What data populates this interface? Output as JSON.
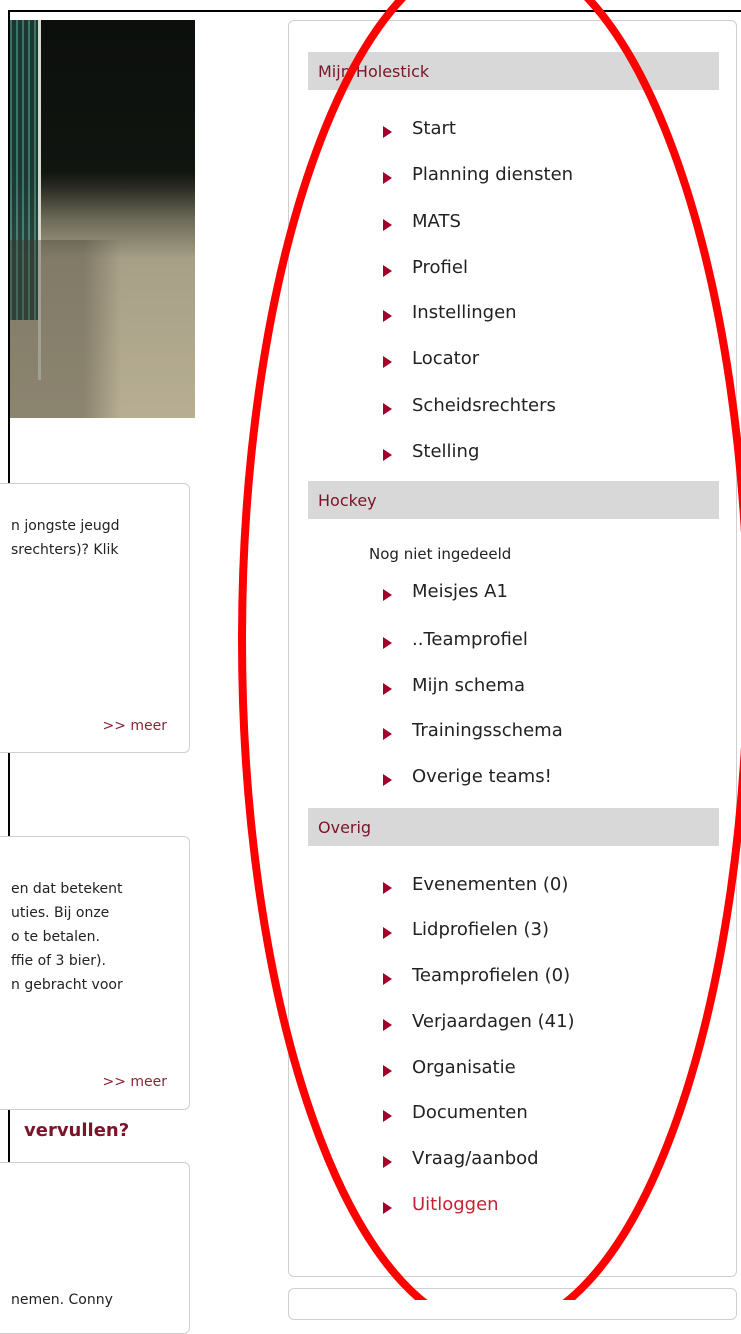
{
  "left_column": {
    "box1": {
      "lines": [
        "n jongste jeugd",
        "srechters)? Klik"
      ],
      "more_link": ">> meer"
    },
    "box2": {
      "lines": [
        "en dat betekent",
        "uties. Bij onze",
        "o te betalen.",
        "ffie of 3 bier).",
        "n gebracht voor"
      ],
      "more_link": ">> meer"
    },
    "heading": "vervullen?",
    "box3": {
      "lines": [
        "nemen. Conny"
      ]
    }
  },
  "sidebar": {
    "sections": [
      {
        "title": "Mijn Holestick",
        "items": [
          "Start",
          "Planning diensten",
          "MATS",
          "Profiel",
          "Instellingen",
          "Locator",
          "Scheidsrechters",
          "Stelling"
        ]
      },
      {
        "title": "Hockey",
        "subheading": "Nog niet ingedeeld",
        "items": [
          "Meisjes A1",
          "..Teamprofiel",
          "Mijn schema",
          "Trainingsschema",
          "Overige teams!"
        ]
      },
      {
        "title": "Overig",
        "items": [
          "Evenementen (0)",
          "Lidprofielen (3)",
          "Teamprofielen (0)",
          "Verjaardagen (41)",
          "Organisatie",
          "Documenten",
          "Vraag/aanbod",
          "Uitloggen"
        ]
      }
    ]
  },
  "colors": {
    "accent": "#7a1428",
    "arrow": "#a3002a",
    "logout": "#c42233",
    "header_bg": "#d8d8d8",
    "annotation": "#ff0000"
  }
}
